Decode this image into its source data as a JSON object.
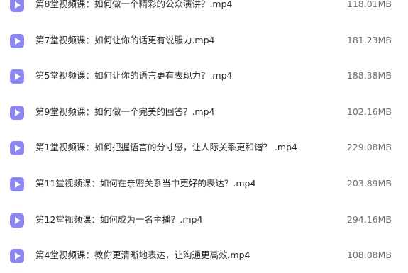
{
  "accent_color": "#8d87f5",
  "files": [
    {
      "icon": "video-file-icon",
      "name": "第8堂视频课：如何做一个精彩的公众演讲？.mp4",
      "size": "118.01MB"
    },
    {
      "icon": "video-file-icon",
      "name": "第7堂视频课：如何让你的话更有说服力.mp4",
      "size": "181.23MB"
    },
    {
      "icon": "video-file-icon",
      "name": "第5堂视频课：如何让你的语言更有表现力？.mp4",
      "size": "188.38MB"
    },
    {
      "icon": "video-file-icon",
      "name": "第9堂视频课：如何做一个完美的回答？.mp4",
      "size": "102.16MB"
    },
    {
      "icon": "video-file-icon",
      "name": "第1堂视频课：如何把握语言的分寸感，让人际关系更和谐？ .mp4",
      "size": "229.08MB"
    },
    {
      "icon": "video-file-icon",
      "name": "第11堂视频课：如何在亲密关系当中更好的表达？.mp4",
      "size": "203.89MB"
    },
    {
      "icon": "video-file-icon",
      "name": "第12堂视频课：如何成为一名主播？.mp4",
      "size": "294.16MB"
    },
    {
      "icon": "video-file-icon",
      "name": "第4堂视频课：教你更清晰地表达，让沟通更高效.mp4",
      "size": "108.08MB"
    }
  ]
}
